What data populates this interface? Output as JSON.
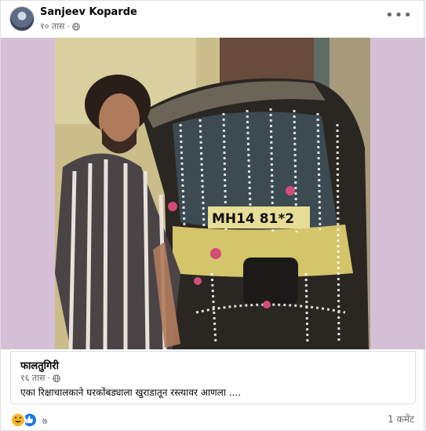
{
  "post": {
    "author": "Sanjeev Koparde",
    "time": "१० तास",
    "privacy_icon": "globe-icon",
    "more_icon": "more-horizontal-icon"
  },
  "photo": {
    "plate_text": "MH14 81*2"
  },
  "link_preview": {
    "title": "फालतुगिरी",
    "time": "१६ तास",
    "description": "एका रिक्षाचालकाने घरकोंबड्याला खुराडातून रस्त्यावर आणला ...."
  },
  "footer": {
    "reaction_count": "७",
    "comments": "1 कमेंट"
  },
  "colors": {
    "photo_side_background": "#d5bfd6",
    "like_blue": "#1877f2",
    "haha_yellow": "#f7b928",
    "secondary_text": "#65676b"
  }
}
